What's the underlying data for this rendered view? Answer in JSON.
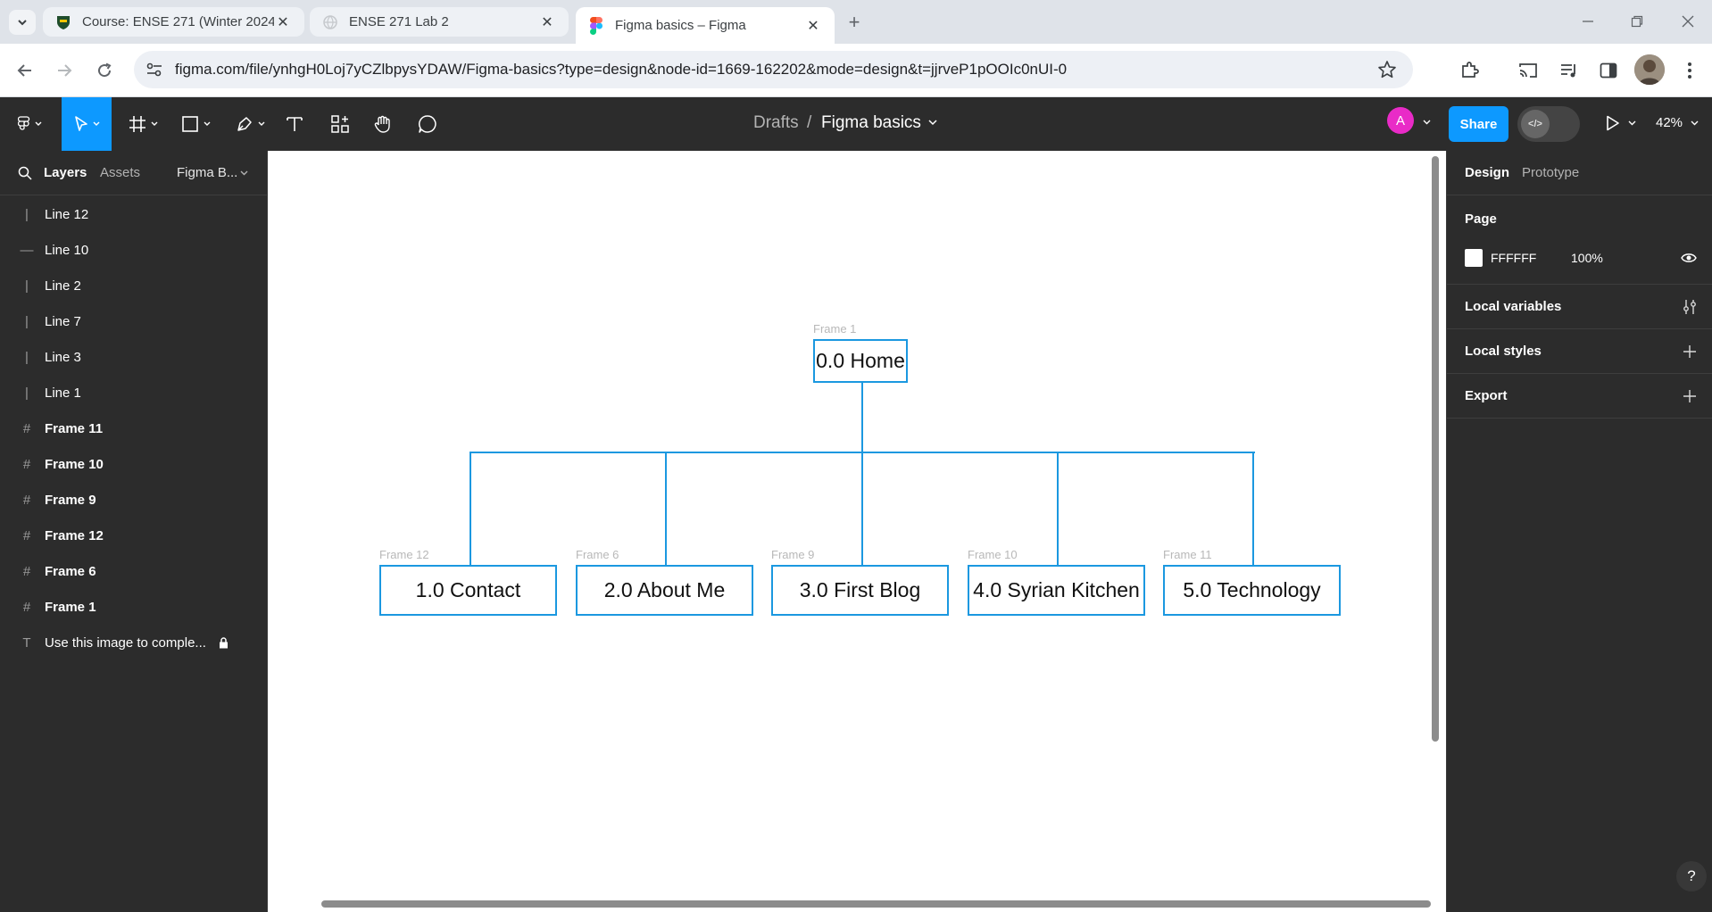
{
  "browser": {
    "tabs": [
      {
        "title": "Course: ENSE 271 (Winter 2024)"
      },
      {
        "title": "ENSE 271 Lab 2"
      },
      {
        "title": "Figma basics – Figma"
      }
    ],
    "url": "figma.com/file/ynhgH0Loj7yCZlbpysYDAW/Figma-basics?type=design&node-id=1669-162202&mode=design&t=jjrveP1pOOIc0nUI-0"
  },
  "figma_toolbar": {
    "breadcrumb_parent": "Drafts",
    "breadcrumb_separator": "/",
    "file_name": "Figma basics",
    "avatar_letter": "A",
    "share_label": "Share",
    "zoom": "42%"
  },
  "left_panel": {
    "tabs": [
      "Layers",
      "Assets"
    ],
    "page_selector": "Figma B...",
    "layers": [
      {
        "name": "Line 12",
        "type": "vline"
      },
      {
        "name": "Line 10",
        "type": "hline"
      },
      {
        "name": "Line 2",
        "type": "vline"
      },
      {
        "name": "Line 7",
        "type": "vline"
      },
      {
        "name": "Line 3",
        "type": "vline"
      },
      {
        "name": "Line 1",
        "type": "vline"
      },
      {
        "name": "Frame 11",
        "type": "frame"
      },
      {
        "name": "Frame 10",
        "type": "frame"
      },
      {
        "name": "Frame 9",
        "type": "frame"
      },
      {
        "name": "Frame 12",
        "type": "frame"
      },
      {
        "name": "Frame 6",
        "type": "frame"
      },
      {
        "name": "Frame 1",
        "type": "frame"
      },
      {
        "name": "Use this image to comple...",
        "type": "text",
        "locked": true
      }
    ]
  },
  "canvas": {
    "root": {
      "frame_label": "Frame 1",
      "text": "0.0 Home"
    },
    "children": [
      {
        "frame_label": "Frame 12",
        "text": "1.0 Contact"
      },
      {
        "frame_label": "Frame 6",
        "text": "2.0 About Me"
      },
      {
        "frame_label": "Frame 9",
        "text": "3.0 First Blog"
      },
      {
        "frame_label": "Frame 10",
        "text": "4.0 Syrian Kitchen"
      },
      {
        "frame_label": "Frame 11",
        "text": "5.0 Technology"
      }
    ],
    "accent_color": "#1b98e0"
  },
  "right_panel": {
    "tabs": [
      "Design",
      "Prototype"
    ],
    "page_heading": "Page",
    "page_color": "FFFFFF",
    "page_opacity": "100%",
    "sections": [
      "Local variables",
      "Local styles",
      "Export"
    ]
  },
  "help_label": "?"
}
